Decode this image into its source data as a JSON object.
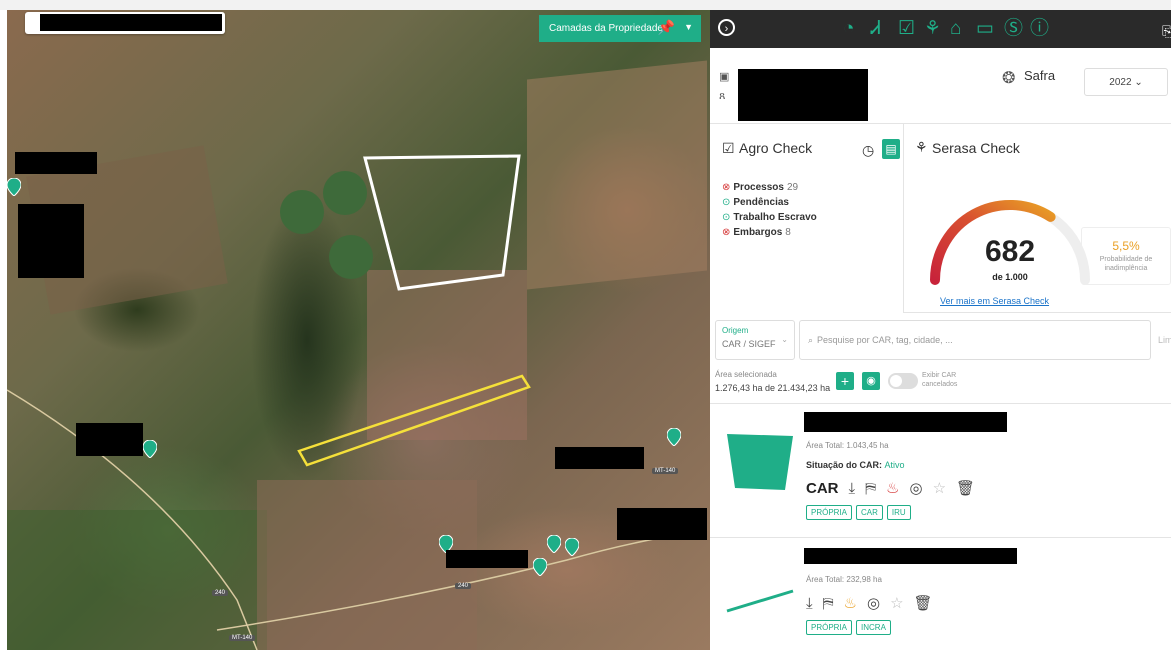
{
  "map": {
    "layers_button_label": "Camadas da Propriedade",
    "road_labels": [
      "MT-140",
      "240",
      "240",
      "MT-140"
    ]
  },
  "header": {
    "icons": [
      "chevron-right-icon",
      "speedometer-icon",
      "person-icon",
      "checkbox-icon",
      "plant-icon",
      "home-icon",
      "folder-icon",
      "dollar-icon",
      "info-icon"
    ]
  },
  "safra": {
    "label": "Safra",
    "year": "2022 ⌄"
  },
  "agro_check": {
    "title": "Agro Check",
    "items": [
      {
        "label": "Processos",
        "count": "29",
        "status": "alert"
      },
      {
        "label": "Pendências",
        "count": "",
        "status": "ok"
      },
      {
        "label": "Trabalho Escravo",
        "count": "",
        "status": "ok"
      },
      {
        "label": "Embargos",
        "count": "8",
        "status": "alert"
      }
    ]
  },
  "serasa_check": {
    "title": "Serasa Check",
    "score": "682",
    "score_of": "de 1.000",
    "score_fraction": 0.682,
    "probability": "5,5%",
    "probability_label": "Probabilidade de inadimplência",
    "link": "Ver mais em Serasa Check"
  },
  "filters": {
    "origin_label": "Origem",
    "origin_value": "CAR / SIGEF",
    "search_placeholder": "Pesquise por CAR, tag, cidade, ...",
    "clear_label": "Lim",
    "area_selected_label": "Área selecionada",
    "area_selected_value": "1.276,43 ha de 21.434,23 ha",
    "show_canceled_label": "Exibir CAR cancelados"
  },
  "properties": [
    {
      "area": "Área Total: 1.043,45 ha",
      "car_status_label": "Situação do CAR:",
      "car_status_value": "Ativo",
      "code_label": "CAR",
      "tags": [
        "PRÓPRIA",
        "CAR",
        "IRU"
      ]
    },
    {
      "area": "Área Total: 232,98 ha",
      "tags": [
        "PRÓPRIA",
        "INCRA"
      ]
    }
  ],
  "colors": {
    "accent": "#1fae88",
    "topbar": "#2a2a2a",
    "gauge_red": "#c8233a",
    "gauge_orange": "#e9a025"
  }
}
